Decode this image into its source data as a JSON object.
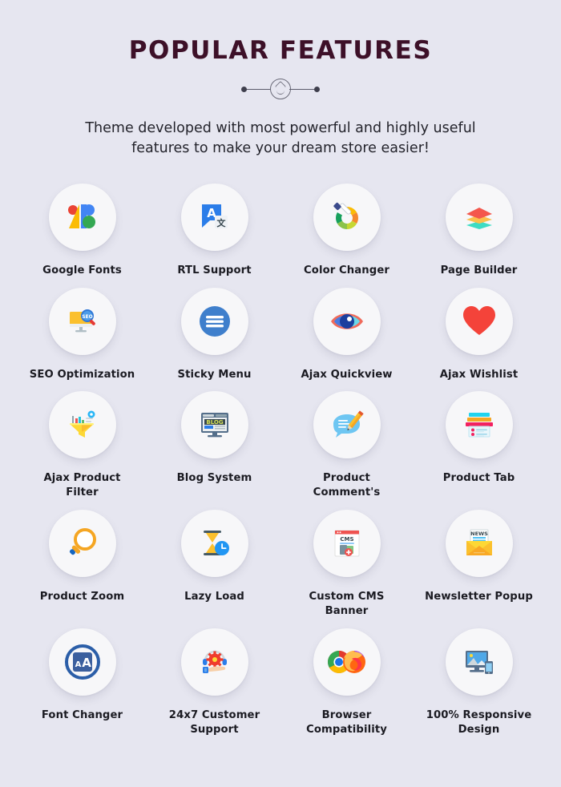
{
  "header": {
    "title": "POPULAR FEATURES",
    "subtitle": "Theme developed with most powerful and highly useful features to make your dream store easier!",
    "subtitle_line1": "Theme developed with most powerful and highly useful",
    "subtitle_line2": "features to make your dream store easier!",
    "title_color": "#3d1028",
    "background_color": "#e6e6f0",
    "divider_icon": "face-ornament-icon"
  },
  "features": [
    {
      "label": "Google Fonts",
      "icon": "google-fonts-icon"
    },
    {
      "label": "RTL Support",
      "icon": "translate-icon"
    },
    {
      "label": "Color Changer",
      "icon": "color-wheel-eyedropper-icon"
    },
    {
      "label": "Page Builder",
      "icon": "layers-icon"
    },
    {
      "label": "SEO Optimization",
      "icon": "seo-monitor-magnifier-icon"
    },
    {
      "label": "Sticky Menu",
      "icon": "hamburger-menu-icon"
    },
    {
      "label": "Ajax Quickview",
      "icon": "eye-icon"
    },
    {
      "label": "Ajax Wishlist",
      "icon": "heart-icon"
    },
    {
      "label": "Ajax Product Filter",
      "icon": "funnel-filter-icon"
    },
    {
      "label": "Blog System",
      "icon": "blog-monitor-icon"
    },
    {
      "label": "Product Comment's",
      "icon": "speech-bubble-pencil-icon"
    },
    {
      "label": "Product Tab",
      "icon": "tabs-list-icon"
    },
    {
      "label": "Product Zoom",
      "icon": "magnifier-icon"
    },
    {
      "label": "Lazy Load",
      "icon": "hourglass-clock-icon"
    },
    {
      "label": "Custom CMS Banner",
      "icon": "cms-browser-window-icon"
    },
    {
      "label": "Newsletter Popup",
      "icon": "news-envelope-icon"
    },
    {
      "label": "Font Changer",
      "icon": "font-size-aa-icon"
    },
    {
      "label": "24x7 Customer Support",
      "icon": "headset-gear-hand-icon"
    },
    {
      "label": "Browser Compatibility",
      "icon": "chrome-firefox-icon"
    },
    {
      "label": "100% Responsive Design",
      "icon": "responsive-devices-icon"
    }
  ],
  "palette": {
    "badge_bg": "#f7f7f9",
    "label_color": "#1b1b22",
    "google_red": "#ea4335",
    "google_blue": "#4285f4",
    "google_green": "#34a853",
    "google_yellow": "#fbbc04",
    "accent_red": "#f44336",
    "accent_orange": "#f7a928",
    "accent_teal": "#3ddcc4",
    "accent_pink": "#f2215f",
    "accent_cyan": "#22d3ee"
  }
}
